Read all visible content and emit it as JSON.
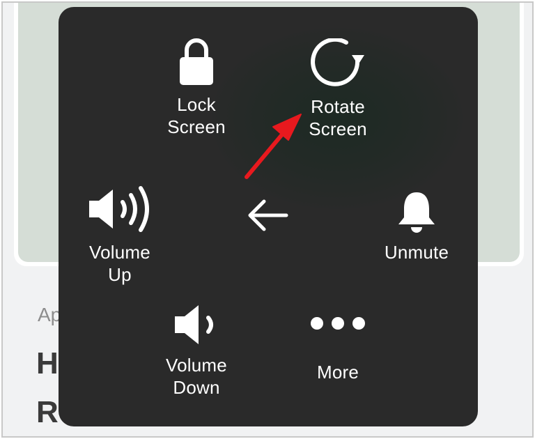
{
  "background": {
    "article_prefix": "Ap",
    "heading_line1": "H",
    "heading_line2": "R"
  },
  "assistive_menu": {
    "items": [
      {
        "id": "lock",
        "label": "Lock\nScreen",
        "icon": "lock-icon"
      },
      {
        "id": "rotate",
        "label": "Rotate\nScreen",
        "icon": "rotate-icon"
      },
      {
        "id": "volume_up",
        "label": "Volume\nUp",
        "icon": "volume-up-icon"
      },
      {
        "id": "back",
        "label": "",
        "icon": "back-arrow-icon"
      },
      {
        "id": "unmute",
        "label": "Unmute",
        "icon": "bell-icon"
      },
      {
        "id": "volume_down",
        "label": "Volume\nDown",
        "icon": "volume-down-icon"
      },
      {
        "id": "more",
        "label": "More",
        "icon": "more-dots-icon"
      }
    ]
  },
  "annotation": {
    "arrow_color": "#e8191e",
    "target": "rotate"
  },
  "colors": {
    "menu_bg": "#2a2a2a",
    "icon_color": "#ffffff",
    "background_card": "#d5ddd6"
  }
}
